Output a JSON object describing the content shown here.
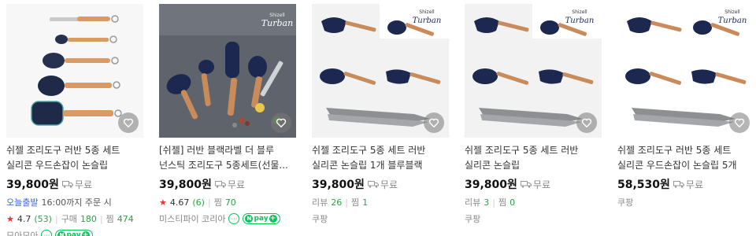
{
  "products": [
    {
      "title": "쉬젤 조리도구 러반 5종 세트 실리콘 우드손잡이 논슬립",
      "price": "39,800원",
      "shipping": "무료",
      "delivery_label": "오늘출발",
      "delivery_time": "16:00까지 주문 시",
      "rating": "4.7",
      "rating_count": "(53)",
      "purchase_label": "구매",
      "purchase_count": "180",
      "wish_label": "찜",
      "wish_count": "474",
      "seller": "모아모아"
    },
    {
      "title": "[쉬젤] 러반 블랙라벨 더 블루 넌스틱 조리도구 5종세트(선물...",
      "price": "39,800원",
      "shipping": "무료",
      "rating": "4.67",
      "rating_count": "(6)",
      "wish_label": "찜",
      "wish_count": "70",
      "seller": "미스티파이 코리아"
    },
    {
      "title": "쉬젤 조리도구 5종 세트 러반 실리콘 논슬립 1개 블루블랙",
      "price": "39,800원",
      "shipping": "무료",
      "review_label": "리뷰",
      "review_count": "26",
      "wish_label": "찜",
      "wish_count": "1",
      "seller": "쿠팡"
    },
    {
      "title": "쉬젤 조리도구 5종 세트 러반 실리콘 논슬립",
      "price": "39,800원",
      "shipping": "무료",
      "review_label": "리뷰",
      "review_count": "3",
      "wish_label": "찜",
      "wish_count": "0",
      "seller": "쿠팡"
    },
    {
      "title": "쉬젤 조리도구 러반 5종 세트 실리콘 우드손잡이 논슬립 5개",
      "price": "58,530원",
      "shipping": "무료",
      "seller": "쿠팡"
    }
  ],
  "brand_logo_text": "Turban",
  "brand_logo_sub": "Shizell",
  "npay_text": "pay",
  "colors": {
    "star": "#f5302f",
    "green": "#29a347",
    "delivery": "#3b64d7",
    "npay": "#03c75a"
  }
}
